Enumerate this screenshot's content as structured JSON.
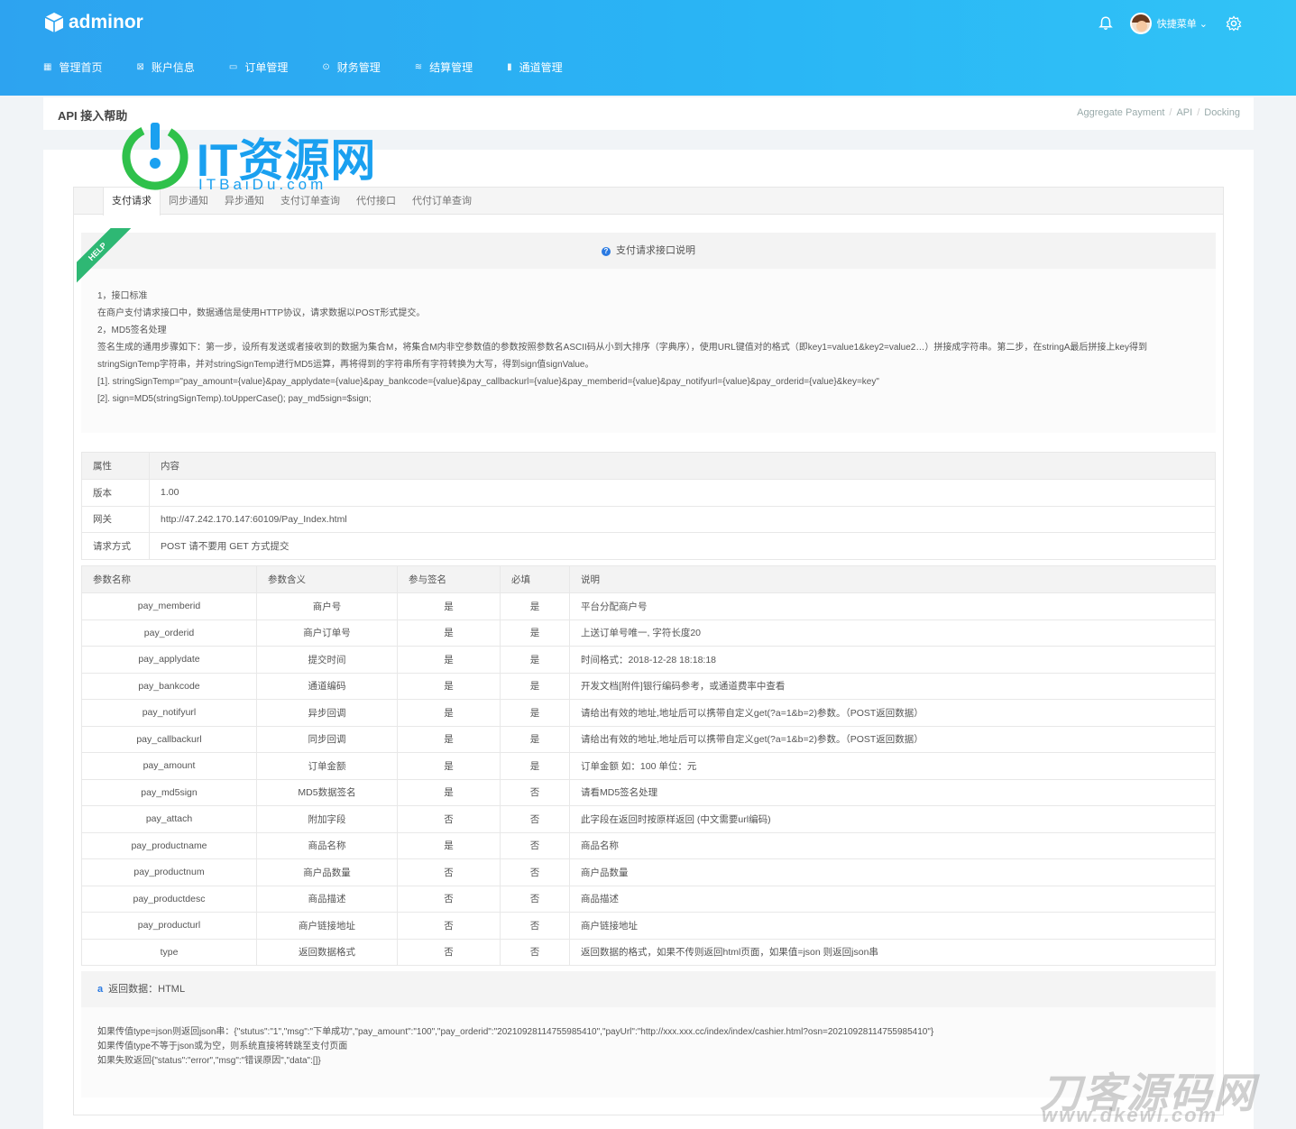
{
  "brand": {
    "name": "adminor"
  },
  "user": {
    "name": "快捷菜单",
    "caret": "⌄"
  },
  "nav": [
    {
      "icon": "▦",
      "label": "管理首页"
    },
    {
      "icon": "⊠",
      "label": "账户信息"
    },
    {
      "icon": "▭",
      "label": "订单管理"
    },
    {
      "icon": "⊙",
      "label": "财务管理"
    },
    {
      "icon": "≋",
      "label": "结算管理"
    },
    {
      "icon": "▮",
      "label": "通道管理"
    }
  ],
  "page": {
    "title": "API 接入帮助"
  },
  "breadcrumb": [
    "Aggregate Payment",
    "API",
    "Docking"
  ],
  "watermark": {
    "title": "IT资源网",
    "sub": "ITBaiDu.com",
    "bottom": "刀客源码网",
    "bottom_sub": "www.dkewl.com"
  },
  "tabs": [
    "支付请求",
    "同步通知",
    "异步通知",
    "支付订单查询",
    "代付接口",
    "代付订单查询"
  ],
  "help": {
    "ribbon": "HELP",
    "title": "支付请求接口说明",
    "lines": [
      "1，接口标准",
      "在商户支付请求接口中，数据通信是使用HTTP协议，请求数据以POST形式提交。",
      "2，MD5签名处理",
      "签名生成的通用步骤如下：第一步，设所有发送或者接收到的数据为集合M，将集合M内非空参数值的参数按照参数名ASCII码从小到大排序（字典序），使用URL键值对的格式（即key1=value1&key2=value2…）拼接成字符串。第二步，在stringA最后拼接上key得到stringSignTemp字符串，并对stringSignTemp进行MD5运算，再将得到的字符串所有字符转换为大写，得到sign值signValue。",
      "[1]. stringSignTemp=\"pay_amount={value}&pay_applydate={value}&pay_bankcode={value}&pay_callbackurl={value}&pay_memberid={value}&pay_notifyurl={value}&pay_orderid={value}&key=key\"",
      "[2]. sign=MD5(stringSignTemp).toUpperCase(); pay_md5sign=$sign;"
    ]
  },
  "info_table": {
    "headers": [
      "属性",
      "内容"
    ],
    "rows": [
      [
        "版本",
        "1.00"
      ],
      [
        "网关",
        "http://47.242.170.147:60109/Pay_Index.html"
      ],
      [
        "请求方式",
        "POST 请不要用 GET 方式提交"
      ]
    ]
  },
  "param_table": {
    "headers": [
      "参数名称",
      "参数含义",
      "参与签名",
      "必填",
      "说明"
    ],
    "rows": [
      [
        "pay_memberid",
        "商户号",
        "是",
        "是",
        "平台分配商户号"
      ],
      [
        "pay_orderid",
        "商户订单号",
        "是",
        "是",
        "上送订单号唯一, 字符长度20"
      ],
      [
        "pay_applydate",
        "提交时间",
        "是",
        "是",
        "时间格式：2018-12-28 18:18:18"
      ],
      [
        "pay_bankcode",
        "通道编码",
        "是",
        "是",
        "开发文档[附件]银行编码参考，或通道费率中查看"
      ],
      [
        "pay_notifyurl",
        "异步回调",
        "是",
        "是",
        "请给出有效的地址,地址后可以携带自定义get(?a=1&b=2)参数。（POST返回数据）"
      ],
      [
        "pay_callbackurl",
        "同步回调",
        "是",
        "是",
        "请给出有效的地址,地址后可以携带自定义get(?a=1&b=2)参数。（POST返回数据）"
      ],
      [
        "pay_amount",
        "订单金额",
        "是",
        "是",
        "订单金额 如：100 单位：元"
      ],
      [
        "pay_md5sign",
        "MD5数据签名",
        "是",
        "否",
        "请看MD5签名处理"
      ],
      [
        "pay_attach",
        "附加字段",
        "否",
        "否",
        "此字段在返回时按原样返回 (中文需要url编码)"
      ],
      [
        "pay_productname",
        "商品名称",
        "是",
        "否",
        "商品名称"
      ],
      [
        "pay_productnum",
        "商户品数量",
        "否",
        "否",
        "商户品数量"
      ],
      [
        "pay_productdesc",
        "商品描述",
        "否",
        "否",
        "商品描述"
      ],
      [
        "pay_producturl",
        "商户链接地址",
        "否",
        "否",
        "商户链接地址"
      ],
      [
        "type",
        "返回数据格式",
        "否",
        "否",
        "返回数据的格式，如果不传则返回html页面，如果值=json 则返回json串"
      ]
    ]
  },
  "return": {
    "title": "返回数据：HTML",
    "lines": [
      "如果传值type=json则返回json串：{\"stutus\":\"1\",\"msg\":\"下单成功\",\"pay_amount\":\"100\",\"pay_orderid\":\"20210928114755985410\",\"payUrl\":\"http://xxx.xxx.cc/index/index/cashier.html?osn=20210928114755985410\"}",
      "如果传值type不等于json或为空，则系统直接将转跳至支付页面",
      "如果失败返回{\"status\":\"error\",\"msg\":\"错误原因\",\"data\":[]}"
    ]
  }
}
